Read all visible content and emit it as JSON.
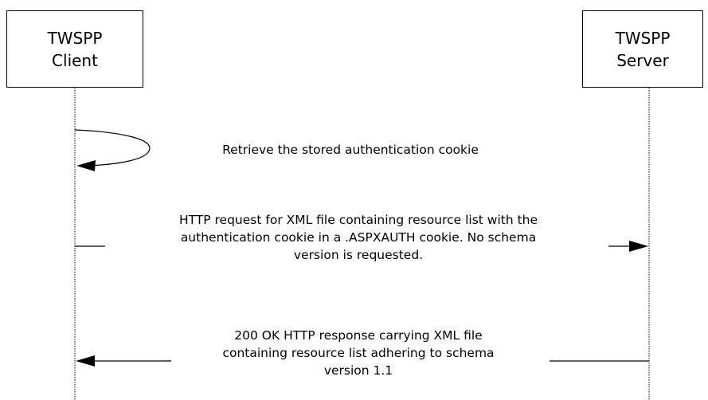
{
  "actors": {
    "client": {
      "name_line1": "TWSPP",
      "name_line2": "Client"
    },
    "server": {
      "name_line1": "TWSPP",
      "name_line2": "Server"
    }
  },
  "messages": [
    {
      "from": "client",
      "to": "client",
      "kind": "self",
      "lines": [
        "Retrieve the stored authentication cookie"
      ]
    },
    {
      "from": "client",
      "to": "server",
      "kind": "request",
      "lines": [
        "HTTP request for XML file containing resource list with the",
        "authentication cookie in a .ASPXAUTH cookie.  No schema",
        "version is requested."
      ]
    },
    {
      "from": "server",
      "to": "client",
      "kind": "response",
      "lines": [
        "200 OK HTTP response carrying XML file",
        "containing resource list adhering to schema",
        "version 1.1"
      ]
    }
  ],
  "colors": {
    "line": "#000000",
    "background": "#ffffff"
  }
}
